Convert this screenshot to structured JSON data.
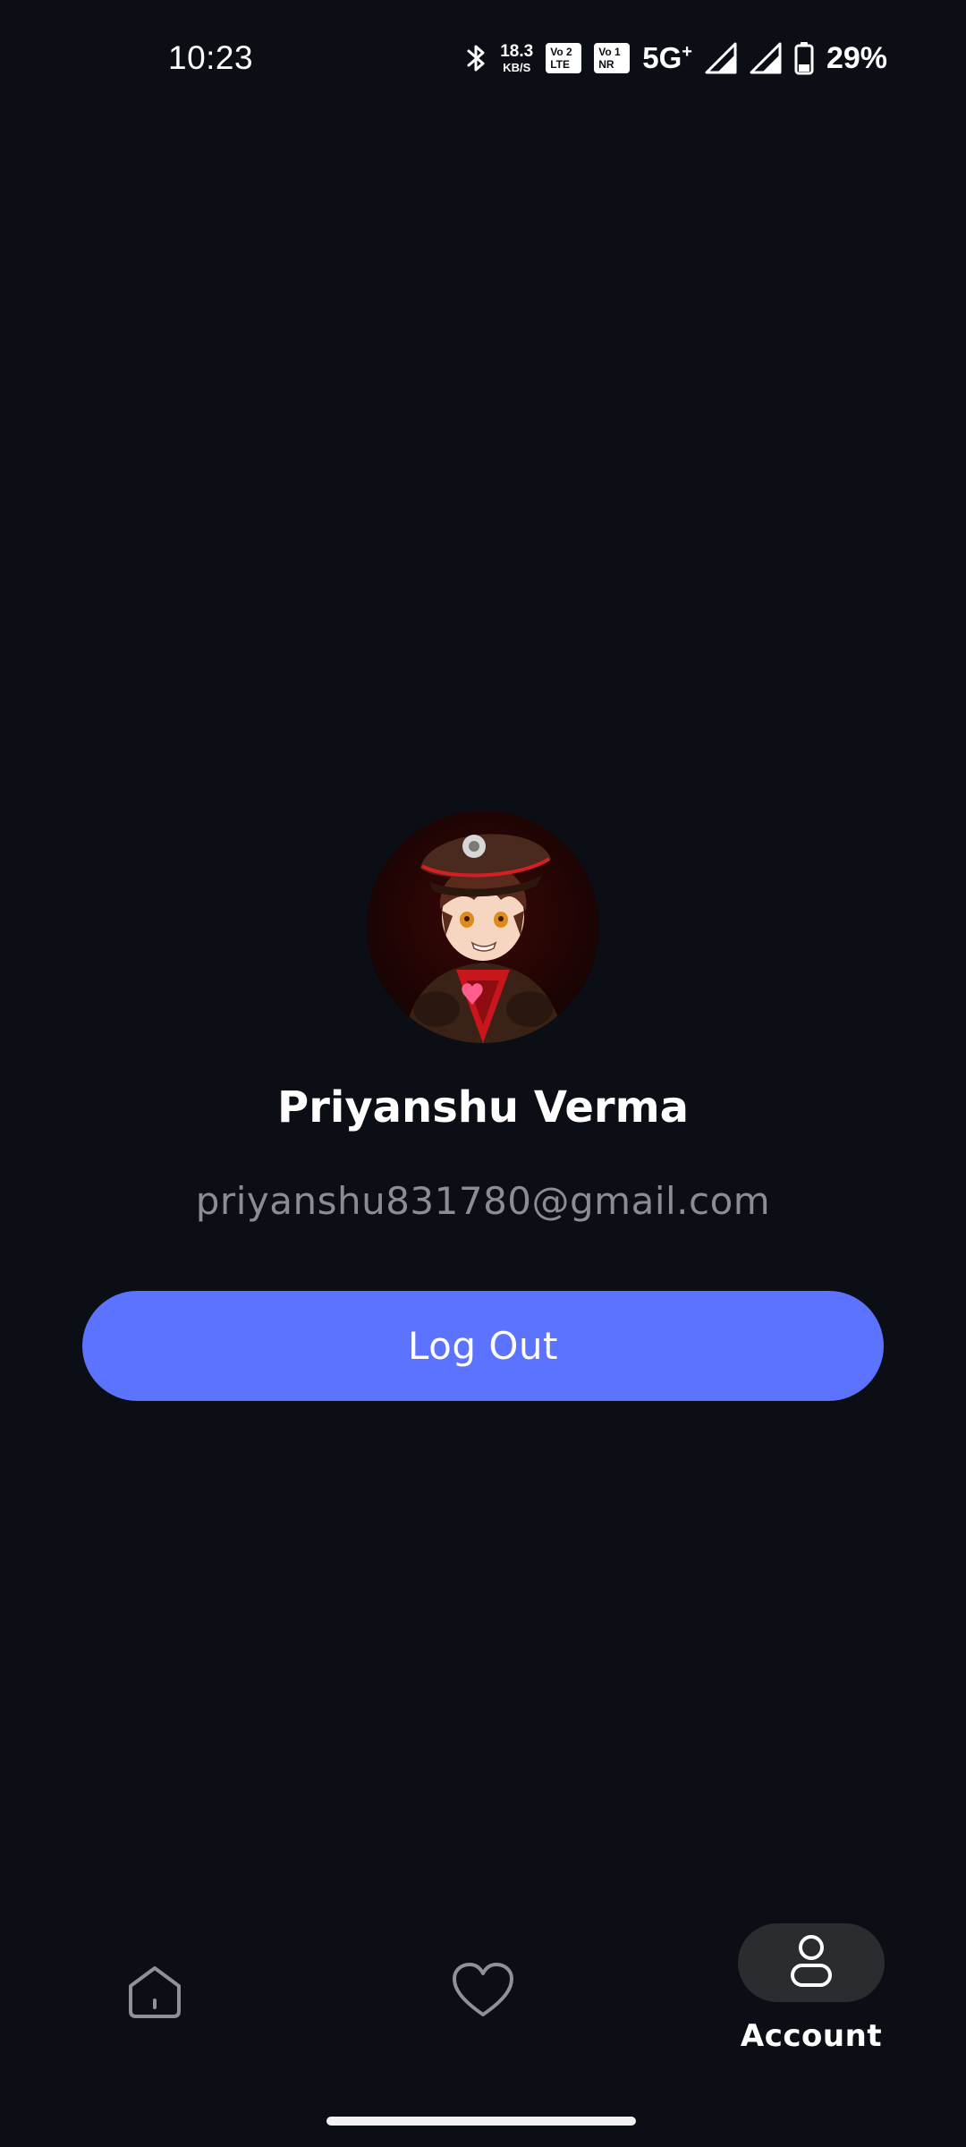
{
  "status_bar": {
    "time": "10:23",
    "speed_value": "18.3",
    "speed_unit": "KB/S",
    "volte1_top": "Vo",
    "volte1_sim": "2",
    "volte1_bottom": "LTE",
    "volte2_top": "Vo",
    "volte2_sim": "1",
    "volte2_bottom": "NR",
    "network": "5G",
    "network_plus": "+",
    "battery": "29%",
    "icons": [
      "bluetooth-icon",
      "signal-icon",
      "signal-icon",
      "battery-icon"
    ]
  },
  "profile": {
    "name": "Priyanshu Verma",
    "email": "priyanshu831780@gmail.com"
  },
  "actions": {
    "logout_label": "Log Out"
  },
  "nav": {
    "account_label": "Account",
    "items": [
      "home-icon",
      "heart-icon",
      "account-icon"
    ]
  },
  "colors": {
    "background": "#0b0e14",
    "accent": "#5b73ff",
    "muted_text": "#8a8d93",
    "pill": "#2b2c30"
  }
}
